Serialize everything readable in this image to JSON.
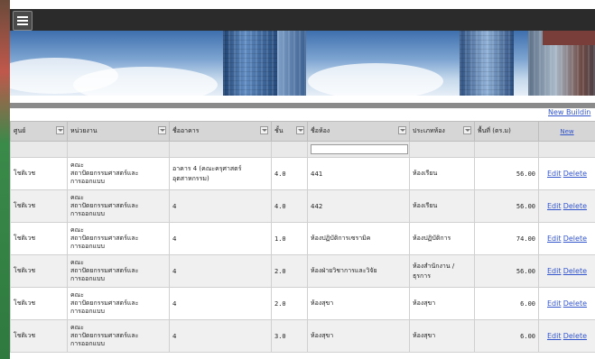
{
  "header": {
    "menu_icon": "hamburger-menu-icon"
  },
  "links": {
    "new_building": "New Buildin"
  },
  "table": {
    "columns": [
      {
        "key": "center",
        "label": "ศูนย์"
      },
      {
        "key": "agency",
        "label": "หน่วยงาน"
      },
      {
        "key": "building",
        "label": "ชื่ออาคาร"
      },
      {
        "key": "floor",
        "label": "ชั้น"
      },
      {
        "key": "room",
        "label": "ชื่อห้อง"
      },
      {
        "key": "type",
        "label": "ประเภทห้อง"
      },
      {
        "key": "area",
        "label": "พื้นที่ (ตร.ม)"
      },
      {
        "key": "actions",
        "label": "New"
      }
    ],
    "edit_label": "Edit",
    "delete_label": "Delete",
    "rows": [
      {
        "center": "โชติเวช",
        "agency": [
          "คณะ",
          "สถาปัตยกรรมศาสตร์และ",
          "การออกแบบ"
        ],
        "building": "อาคาร 4 (คณะครุศาสตร์อุตสาหกรรม)",
        "floor": "4.0",
        "room": "441",
        "type": "ห้องเรียน",
        "area": "56.00"
      },
      {
        "center": "โชติเวช",
        "agency": [
          "คณะ",
          "สถาปัตยกรรมศาสตร์และ",
          "การออกแบบ"
        ],
        "building": "4",
        "floor": "4.0",
        "room": "442",
        "type": "ห้องเรียน",
        "area": "56.00"
      },
      {
        "center": "โชติเวช",
        "agency": [
          "คณะ",
          "สถาปัตยกรรมศาสตร์และ",
          "การออกแบบ"
        ],
        "building": "4",
        "floor": "1.0",
        "room": "ห้องปฏิบัติการเซรามิค",
        "type": "ห้องปฏิบัติการ",
        "area": "74.00"
      },
      {
        "center": "โชติเวช",
        "agency": [
          "คณะ",
          "สถาปัตยกรรมศาสตร์และ",
          "การออกแบบ"
        ],
        "building": "4",
        "floor": "2.0",
        "room": "ห้องฝ่ายวิชาการและวิจัย",
        "type": "ห้องสำนักงาน / ธุรการ",
        "area": "56.00"
      },
      {
        "center": "โชติเวช",
        "agency": [
          "คณะ",
          "สถาปัตยกรรมศาสตร์และ",
          "การออกแบบ"
        ],
        "building": "4",
        "floor": "2.0",
        "room": "ห้องสุขา",
        "type": "ห้องสุขา",
        "area": "6.00"
      },
      {
        "center": "โชติเวช",
        "agency": [
          "คณะ",
          "สถาปัตยกรรมศาสตร์และ",
          "การออกแบบ"
        ],
        "building": "4",
        "floor": "3.0",
        "room": "ห้องสุขา",
        "type": "ห้องสุขา",
        "area": "6.00"
      }
    ]
  }
}
